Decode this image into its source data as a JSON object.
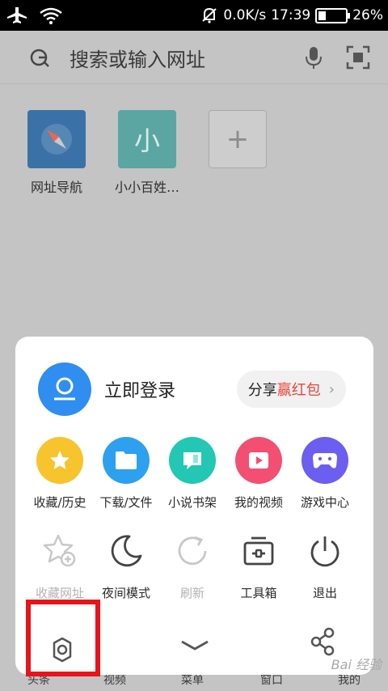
{
  "status_bar": {
    "speed": "0.0K/s",
    "time": "17:39",
    "battery": "26%",
    "battery_level": 0.26
  },
  "search": {
    "placeholder": "搜索或输入网址"
  },
  "shortcuts": [
    {
      "label": "网址导航",
      "icon": "compass-icon"
    },
    {
      "label": "小小百姓…",
      "icon": "letter-tile",
      "glyph": "小"
    },
    {
      "label": "",
      "icon": "add-icon"
    }
  ],
  "bottom_nav": [
    "头条",
    "视频",
    "菜单",
    "窗口",
    "我的"
  ],
  "menu": {
    "login_label": "立即登录",
    "share_prefix": "分享",
    "share_highlight": "赢红包",
    "share_arrow": "›",
    "row1": [
      {
        "label": "收藏/历史",
        "icon": "star-icon",
        "color": "#f7c42d"
      },
      {
        "label": "下载/文件",
        "icon": "folder-icon",
        "color": "#2ea0f0"
      },
      {
        "label": "小说书架",
        "icon": "book-icon",
        "color": "#23c7b3"
      },
      {
        "label": "我的视频",
        "icon": "play-icon",
        "color": "#f24f72"
      },
      {
        "label": "游戏中心",
        "icon": "gamepad-icon",
        "color": "#6b5ef0"
      }
    ],
    "row2": [
      {
        "label": "收藏网址",
        "icon": "star-add-icon",
        "enabled": false
      },
      {
        "label": "夜间模式",
        "icon": "moon-icon",
        "enabled": true
      },
      {
        "label": "刷新",
        "icon": "refresh-icon",
        "enabled": false
      },
      {
        "label": "工具箱",
        "icon": "toolbox-icon",
        "enabled": true
      },
      {
        "label": "退出",
        "icon": "power-icon",
        "enabled": true
      }
    ]
  },
  "watermark": "Bai 经验",
  "highlight_color": "#e8141c"
}
